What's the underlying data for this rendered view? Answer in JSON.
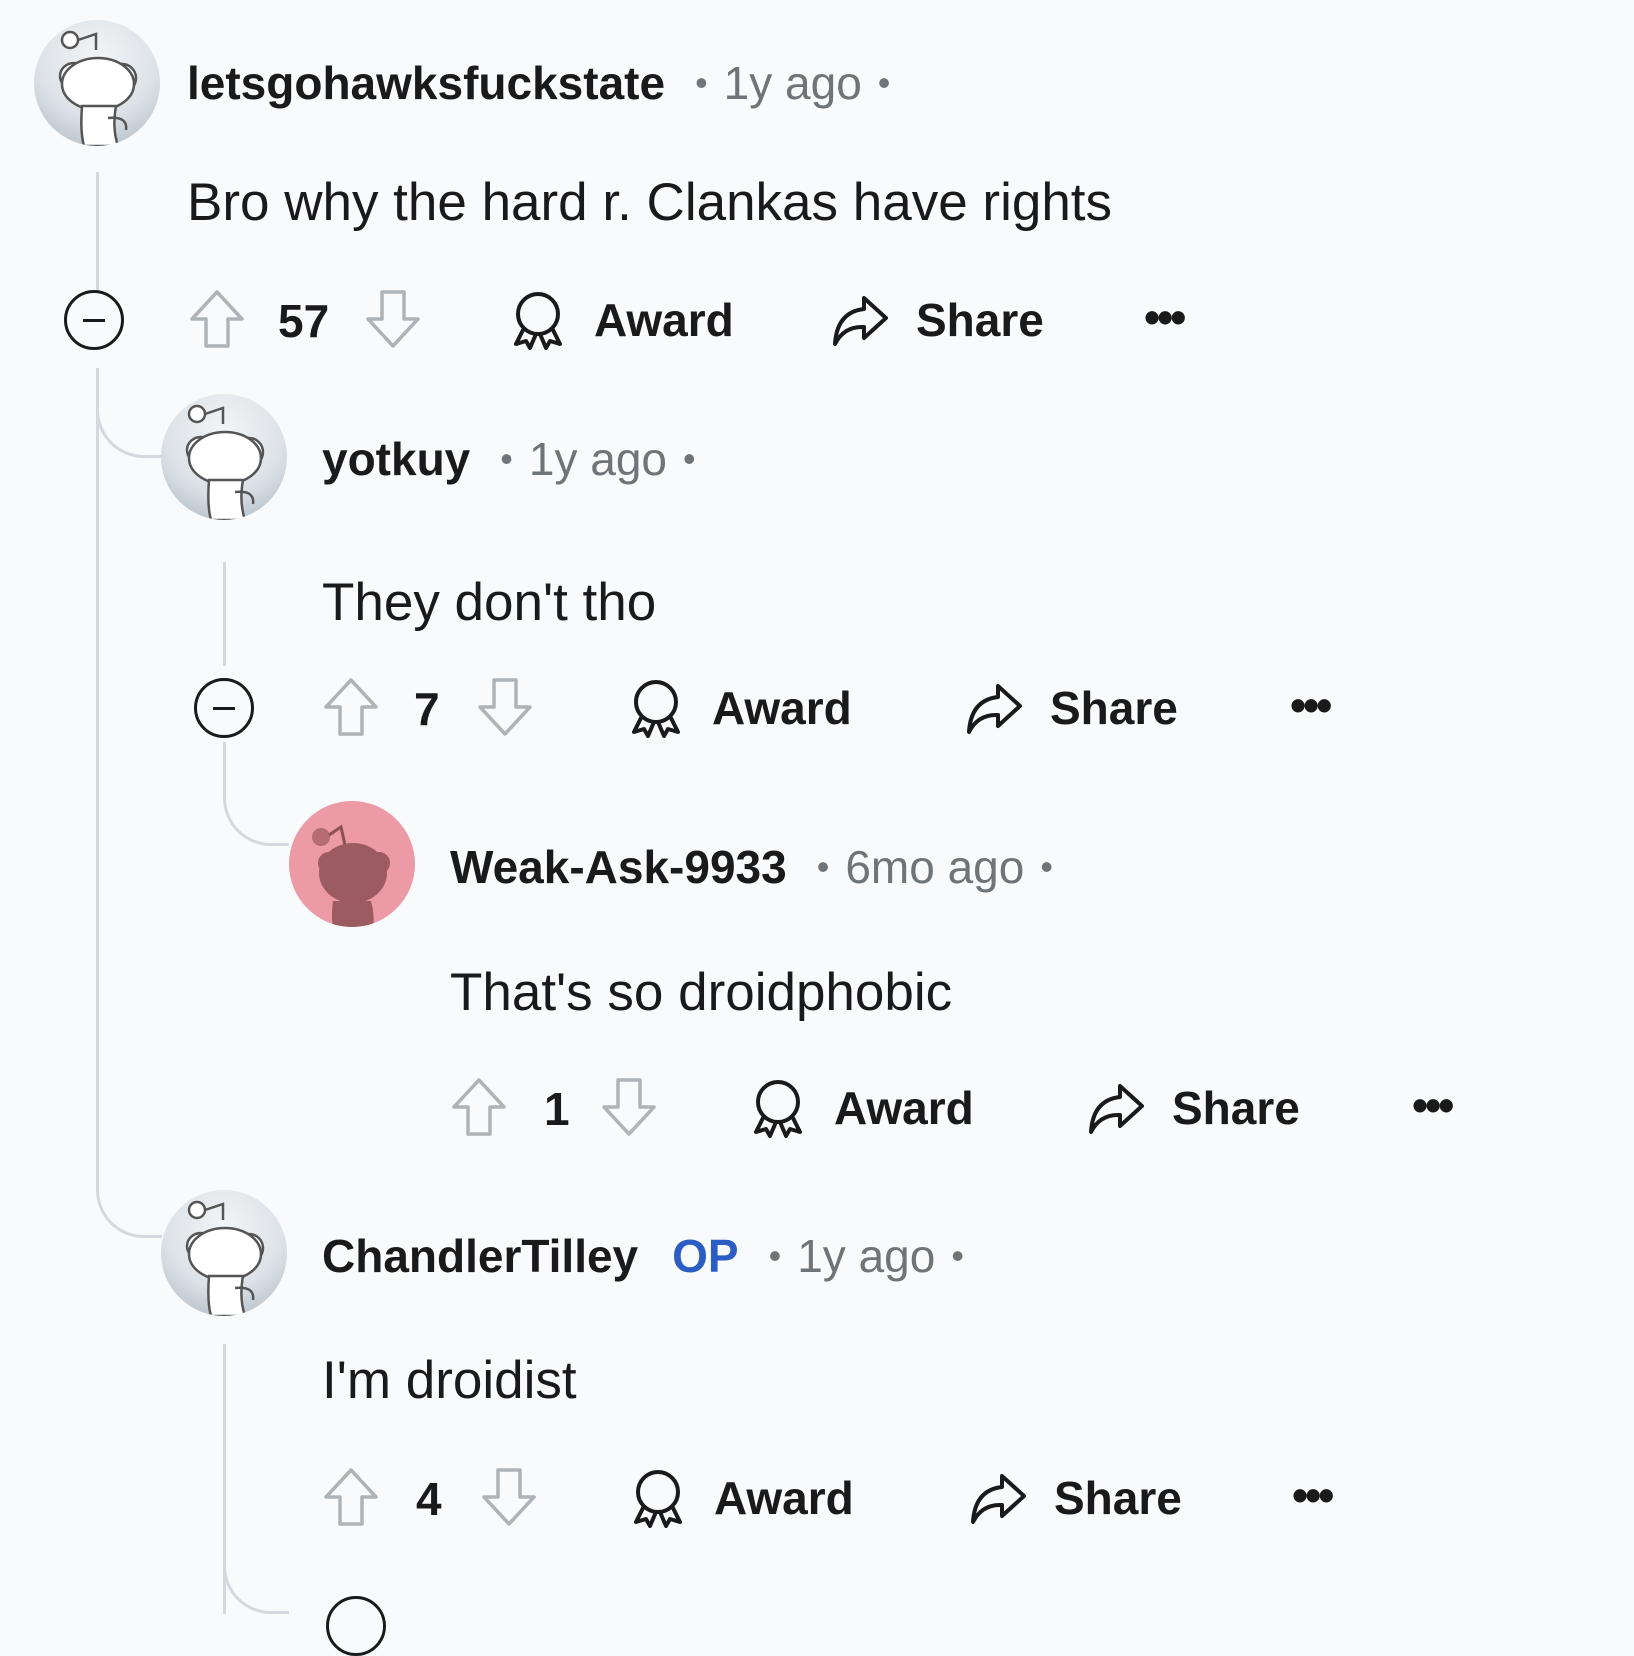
{
  "comments": [
    {
      "username": "letsgohawksfuckstate",
      "op": "",
      "time": "1y ago",
      "body": "Bro why the hard r. Clankas have rights",
      "score": "57",
      "award": "Award",
      "share": "Share",
      "more": "•••",
      "avatar": "gray"
    },
    {
      "username": "yotkuy",
      "op": "",
      "time": "1y ago",
      "body": "They don't tho",
      "score": "7",
      "award": "Award",
      "share": "Share",
      "more": "•••",
      "avatar": "gray"
    },
    {
      "username": "Weak-Ask-9933",
      "op": "",
      "time": "6mo ago",
      "body": "That's so droidphobic",
      "score": "1",
      "award": "Award",
      "share": "Share",
      "more": "•••",
      "avatar": "pink"
    },
    {
      "username": "ChandlerTilley",
      "op": "OP",
      "time": "1y ago",
      "body": "I'm droidist",
      "score": "4",
      "award": "Award",
      "share": "Share",
      "more": "•••",
      "avatar": "gray"
    }
  ],
  "separator": "•",
  "colors": {
    "background": "#f9fafc",
    "op": "#2a5ec4",
    "meta": "#6f7478",
    "thread_line": "#d5d9de",
    "pink_avatar": "#ec9aa6"
  }
}
